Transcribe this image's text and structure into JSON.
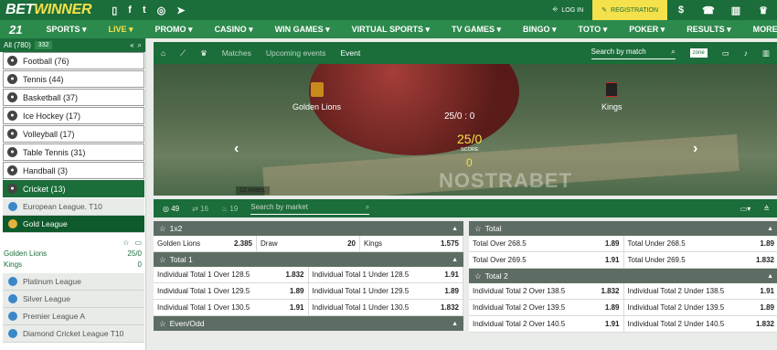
{
  "header": {
    "logo_a": "BET",
    "logo_b": "WINNER",
    "login": "LOG IN",
    "register": "REGISTRATION",
    "icons": [
      "mobile-icon",
      "facebook-icon",
      "twitter-icon",
      "instagram-icon",
      "telegram-icon"
    ],
    "right_icons": [
      "dollar-icon",
      "phone-icon",
      "stats-icon",
      "trophy-icon"
    ]
  },
  "nav": {
    "logo": "21",
    "items": [
      "SPORTS ▾",
      "LIVE ▾",
      "PROMO ▾",
      "CASINO ▾",
      "WIN GAMES ▾",
      "VIRTUAL SPORTS ▾",
      "TV GAMES ▾",
      "BINGO ▾",
      "TOTO ▾",
      "POKER ▾",
      "RESULTS ▾",
      "MORE ▾"
    ]
  },
  "sidebar": {
    "all": "All (780)",
    "count": "332",
    "sports": [
      {
        "label": "Football (76)"
      },
      {
        "label": "Tennis (44)"
      },
      {
        "label": "Basketball (37)"
      },
      {
        "label": "Ice Hockey (17)"
      },
      {
        "label": "Volleyball (17)"
      },
      {
        "label": "Table Tennis (31)"
      },
      {
        "label": "Handball (3)"
      },
      {
        "label": "Cricket (13)"
      }
    ],
    "leagues": [
      {
        "label": "European League. T10"
      },
      {
        "label": "Gold League"
      }
    ],
    "match": {
      "team1": "Golden Lions",
      "score1": "25/0",
      "team2": "Kings",
      "score2": "0"
    },
    "leagues2": [
      {
        "label": "Platinum League"
      },
      {
        "label": "Silver League"
      },
      {
        "label": "Premier League A"
      },
      {
        "label": "Diamond Cricket League T10"
      }
    ]
  },
  "event": {
    "tabs": [
      "Matches",
      "Upcoming events",
      "Event"
    ],
    "search": "Search by match",
    "zone": "zone",
    "team1": "Golden Lions",
    "team2": "Kings",
    "score": "25/0 : 0",
    "score_big": "25/0",
    "score_label": "SCORE",
    "score2": "0",
    "watermark": "NOSTRABET",
    "overs": "12 overs."
  },
  "markets_bar": {
    "c1": "49",
    "c2": "16",
    "c3": "19",
    "search": "Search by market"
  },
  "markets": {
    "left": [
      {
        "title": "1x2",
        "rows": [
          [
            [
              "Golden Lions",
              "2.385"
            ],
            [
              "Draw",
              "20"
            ],
            [
              "Kings",
              "1.575"
            ]
          ]
        ]
      },
      {
        "title": "Total 1",
        "rows": [
          [
            [
              "Individual Total 1 Over 128.5",
              "1.832"
            ],
            [
              "Individual Total 1 Under 128.5",
              "1.91"
            ]
          ],
          [
            [
              "Individual Total 1 Over 129.5",
              "1.89"
            ],
            [
              "Individual Total 1 Under 129.5",
              "1.89"
            ]
          ],
          [
            [
              "Individual Total 1 Over 130.5",
              "1.91"
            ],
            [
              "Individual Total 1 Under 130.5",
              "1.832"
            ]
          ]
        ]
      },
      {
        "title": "Even/Odd",
        "rows": []
      }
    ],
    "right": [
      {
        "title": "Total",
        "rows": [
          [
            [
              "Total Over 268.5",
              "1.89"
            ],
            [
              "Total Under 268.5",
              "1.89"
            ]
          ],
          [
            [
              "Total Over 269.5",
              "1.91"
            ],
            [
              "Total Under 269.5",
              "1.832"
            ]
          ]
        ]
      },
      {
        "title": "Total 2",
        "rows": [
          [
            [
              "Individual Total 2 Over 138.5",
              "1.832"
            ],
            [
              "Individual Total 2 Under 138.5",
              "1.91"
            ]
          ],
          [
            [
              "Individual Total 2 Over 139.5",
              "1.89"
            ],
            [
              "Individual Total 2 Under 139.5",
              "1.89"
            ]
          ],
          [
            [
              "Individual Total 2 Over 140.5",
              "1.91"
            ],
            [
              "Individual Total 2 Under 140.5",
              "1.832"
            ]
          ]
        ]
      }
    ]
  }
}
